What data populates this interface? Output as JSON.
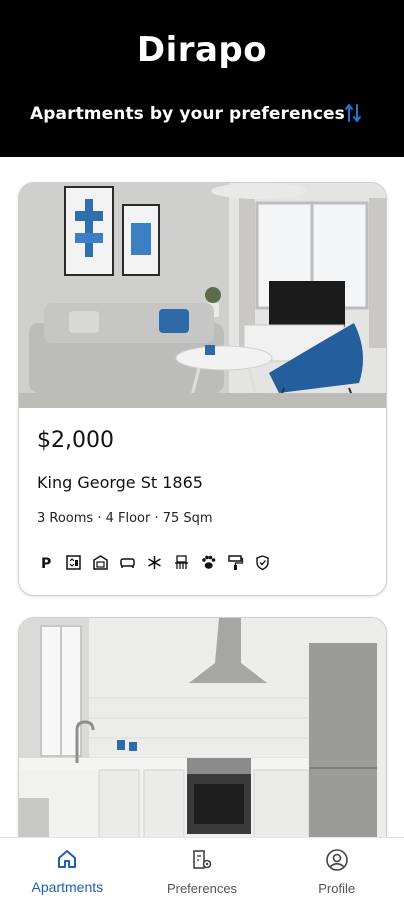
{
  "header": {
    "brand": "Dirapo",
    "subtitle": "Apartments by your preferences",
    "sort_icon": "sort-arrows-icon",
    "accent": "#1e78d6"
  },
  "listings": [
    {
      "price": "$2,000",
      "address": "King George St 1865",
      "details": "3 Rooms · 4 Floor · 75 Sqm",
      "amenities": [
        "parking-icon",
        "elevator-icon",
        "safe-room-icon",
        "sofa-icon",
        "ac-snowflake-icon",
        "balcony-icon",
        "pets-paw-icon",
        "renovated-roller-icon",
        "security-shield-icon"
      ],
      "image": "living-room-photo"
    },
    {
      "image": "kitchen-photo"
    }
  ],
  "nav": {
    "items": [
      {
        "label": "Apartments",
        "icon": "home-icon",
        "active": true
      },
      {
        "label": "Preferences",
        "icon": "preferences-icon",
        "active": false
      },
      {
        "label": "Profile",
        "icon": "profile-icon",
        "active": false
      }
    ],
    "active_color": "#1e5fb3"
  }
}
